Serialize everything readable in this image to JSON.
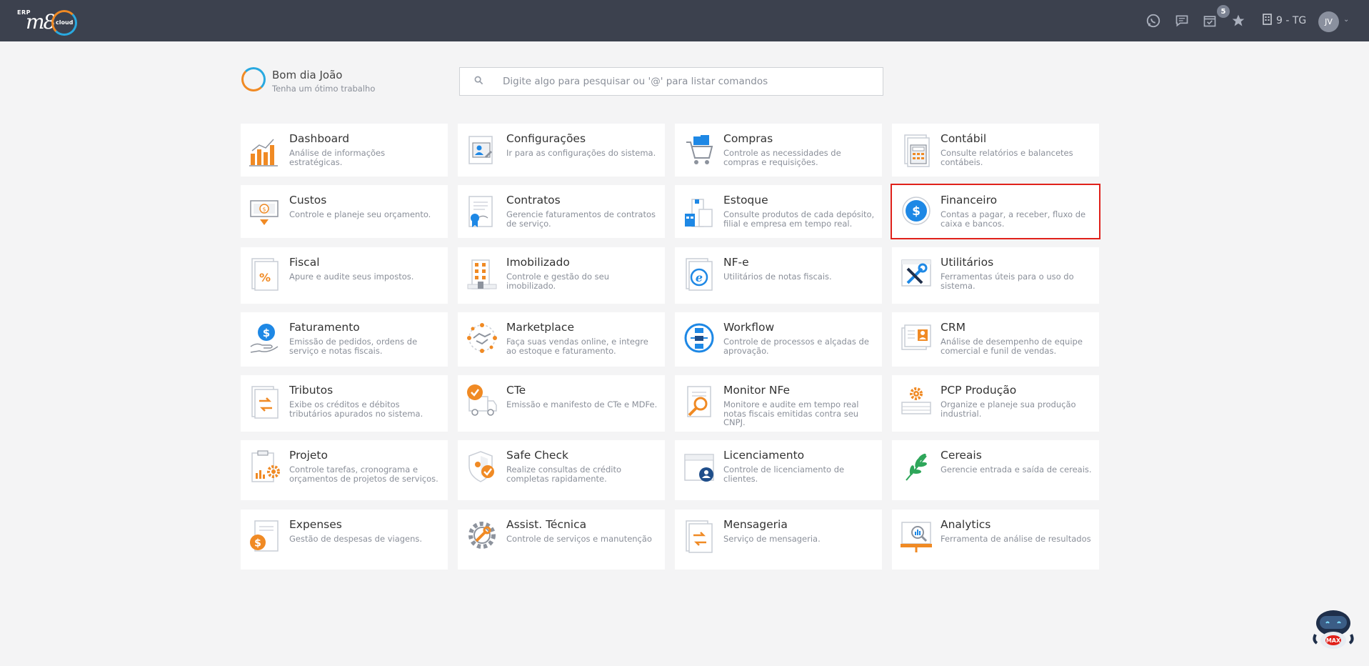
{
  "topbar": {
    "logo_erp": "ERP",
    "logo_m8": "m8",
    "logo_cloud": "cloud",
    "notification_count": "5",
    "company_label": "9 - TG",
    "user_initials": "JV"
  },
  "greeting": {
    "title": "Bom dia João",
    "subtitle": "Tenha um ótimo trabalho"
  },
  "search": {
    "placeholder": "Digite algo para pesquisar ou '@' para listar comandos"
  },
  "modules": [
    {
      "title": "Dashboard",
      "desc": "Análise de informações estratégicas.",
      "icon": "bar-chart-icon"
    },
    {
      "title": "Configurações",
      "desc": "Ir para as configurações do sistema.",
      "icon": "settings-profile-icon"
    },
    {
      "title": "Compras",
      "desc": "Controle as necessidades de compras e requisições.",
      "icon": "shopping-cart-icon"
    },
    {
      "title": "Contábil",
      "desc": "Consulte relatórios e balancetes contábeis.",
      "icon": "calculator-icon"
    },
    {
      "title": "Custos",
      "desc": "Controle e planeje seu orçamento.",
      "icon": "cost-icon"
    },
    {
      "title": "Contratos",
      "desc": "Gerencie faturamentos de contratos de serviço.",
      "icon": "contract-icon"
    },
    {
      "title": "Estoque",
      "desc": "Consulte produtos de cada depósito, filial e empresa em tempo real.",
      "icon": "warehouse-icon"
    },
    {
      "title": "Financeiro",
      "desc": "Contas a pagar, a receber, fluxo de caixa e bancos.",
      "icon": "dollar-circle-icon"
    },
    {
      "title": "Fiscal",
      "desc": "Apure e audite seus impostos.",
      "icon": "percent-document-icon"
    },
    {
      "title": "Imobilizado",
      "desc": "Controle e gestão do seu imobilizado.",
      "icon": "building-icon"
    },
    {
      "title": "NF-e",
      "desc": "Utilitários de notas fiscais.",
      "icon": "e-document-icon"
    },
    {
      "title": "Utilitários",
      "desc": "Ferramentas úteis para o uso do sistema.",
      "icon": "tools-icon"
    },
    {
      "title": "Faturamento",
      "desc": "Emissão de pedidos, ordens de serviço e notas fiscais.",
      "icon": "hand-dollar-icon"
    },
    {
      "title": "Marketplace",
      "desc": "Faça suas vendas online, e integre ao estoque e faturamento.",
      "icon": "handshake-icon"
    },
    {
      "title": "Workflow",
      "desc": "Controle de processos e alçadas de aprovação.",
      "icon": "workflow-icon"
    },
    {
      "title": "CRM",
      "desc": "Análise de desempenho de equipe comercial e funil de vendas.",
      "icon": "crm-icon"
    },
    {
      "title": "Tributos",
      "desc": "Exibe os créditos e débitos tributários apurados no sistema.",
      "icon": "transfer-document-icon"
    },
    {
      "title": "CTe",
      "desc": "Emissão e manifesto de CTe e MDFe.",
      "icon": "truck-check-icon"
    },
    {
      "title": "Monitor NFe",
      "desc": "Monitore e audite em tempo real notas fiscais emitidas contra seu CNPJ.",
      "icon": "magnifier-document-icon"
    },
    {
      "title": "PCP Produção",
      "desc": "Organize e planeje sua produção industrial.",
      "icon": "production-gear-icon"
    },
    {
      "title": "Projeto",
      "desc": "Controle tarefas, cronograma e orçamentos de projetos de serviços.",
      "icon": "clipboard-gear-icon"
    },
    {
      "title": "Safe Check",
      "desc": "Realize consultas de crédito completas rapidamente.",
      "icon": "shield-check-icon"
    },
    {
      "title": "Licenciamento",
      "desc": "Controle de licenciamento de clientes.",
      "icon": "license-icon"
    },
    {
      "title": "Cereais",
      "desc": "Gerencie entrada e saída de cereais.",
      "icon": "leaf-icon"
    },
    {
      "title": "Expenses",
      "desc": "Gestão de despesas de viagens.",
      "icon": "expenses-icon"
    },
    {
      "title": "Assist. Técnica",
      "desc": "Controle de serviços e manutenção",
      "icon": "gear-wrench-icon"
    },
    {
      "title": "Mensageria",
      "desc": "Serviço de mensageria.",
      "icon": "message-document-icon"
    },
    {
      "title": "Analytics",
      "desc": "Ferramenta de análise de resultados",
      "icon": "analytics-board-icon"
    }
  ],
  "highlighted_module": "Financeiro",
  "colors": {
    "topbar": "#3c414e",
    "accent_orange": "#f08a24",
    "accent_blue": "#1e88e5",
    "highlight_border": "#e0211b"
  }
}
